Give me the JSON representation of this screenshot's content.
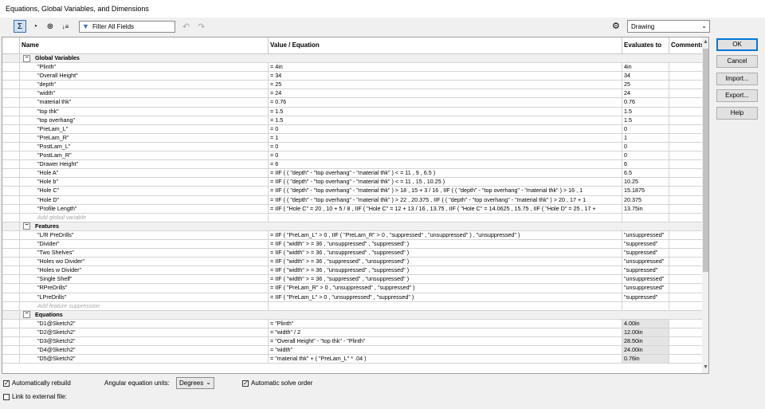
{
  "window": {
    "title": "Equations, Global Variables, and Dimensions"
  },
  "toolbar": {
    "filter_placeholder": "Filter All Fields",
    "configuration": "Drawing",
    "buttons": [
      "equation-view-icon",
      "sketch-equation-view-icon",
      "dimension-view-icon",
      "ordered-view-icon"
    ]
  },
  "columns": {
    "name": "Name",
    "value": "Value / Equation",
    "evaluates": "Evaluates to",
    "comments": "Comments"
  },
  "sections": [
    {
      "title": "Global Variables",
      "add_label": "Add global variable",
      "rows": [
        {
          "name": "\"Plinth\"",
          "value": "= 4in",
          "eval": "4in"
        },
        {
          "name": "\"Overall Height\"",
          "value": "= 34",
          "eval": "34"
        },
        {
          "name": "\"depth\"",
          "value": "= 25",
          "eval": "25"
        },
        {
          "name": "\"width\"",
          "value": "= 24",
          "eval": "24"
        },
        {
          "name": "\"material thk\"",
          "value": "= 0.76",
          "eval": "0.76"
        },
        {
          "name": "\"top thk\"",
          "value": "= 1.5",
          "eval": "1.5"
        },
        {
          "name": "\"top overhang\"",
          "value": "= 1.5",
          "eval": "1.5"
        },
        {
          "name": "\"PreLam_L\"",
          "value": "= 0",
          "eval": "0"
        },
        {
          "name": "\"PreLam_R\"",
          "value": "= 1",
          "eval": "1"
        },
        {
          "name": "\"PostLam_L\"",
          "value": "= 0",
          "eval": "0"
        },
        {
          "name": "\"PostLam_R\"",
          "value": "= 0",
          "eval": "0"
        },
        {
          "name": "\"Drawer Height\"",
          "value": "= 6",
          "eval": "6"
        },
        {
          "name": "\"Hole A\"",
          "value": "= IIF ( ( \"depth\" - \"top overhang\" - \"material thk\" ) < = 11 , 9 , 6.5 )",
          "eval": "6.5"
        },
        {
          "name": "\"Hole b\"",
          "value": "= IIF ( ( \"depth\" - \"top overhang\" - \"material thk\" ) < = 11 , 15 , 10.25 )",
          "eval": "10.25"
        },
        {
          "name": "\"Hole C\"",
          "value": "= IIF ( ( \"depth\" - \"top overhang\" - \"material thk\" ) > 18 , 15 + 3 / 16 , IIF ( ( \"depth\" - \"top overhang\" - \"material thk\" ) > 16 , 1",
          "eval": "15.1875"
        },
        {
          "name": "\"Hole D\"",
          "value": "= IIF ( ( \"depth\" - \"top overhang\" - \"material thk\" ) > 22 , 20.375 , IIF ( ( \"depth\" - \"top overhang\" - \"material thk\" ) > 20 , 17 + 1",
          "eval": "20.375"
        },
        {
          "name": "\"Profile Length\"",
          "value": "= IIF ( \"Hole C\" = 20 , 10 + 5 / 8 , IIF ( \"Hole C\" = 12 + 13 / 16 , 13.75 , IIF ( \"Hole C\" = 14.0625 , 15.75 , IIF ( \"Hole D\" = 25 , 17 +",
          "eval": "13.75in"
        }
      ]
    },
    {
      "title": "Features",
      "add_label": "Add feature suppression",
      "rows": [
        {
          "name": "\"L/R PreDrills\"",
          "value": "= IIF ( \"PreLam_L\" > 0 , IIF ( \"PreLam_R\" > 0 , \"suppressed\" , \"unsuppressed\" ) , \"unsuppressed\" )",
          "eval": "\"unsuppressed\""
        },
        {
          "name": "\"Divider\"",
          "value": "= IIF ( \"width\" > = 36 , \"unsuppressed\" , \"suppressed\" )",
          "eval": "\"suppressed\""
        },
        {
          "name": "\"Two Shelves\"",
          "value": "= IIF ( \"width\" > = 36 , \"unsuppressed\" , \"suppressed\" )",
          "eval": "\"suppressed\""
        },
        {
          "name": "\"Holes wo Divider\"",
          "value": "= IIF ( \"width\" > = 36 , \"suppressed\" , \"unsuppressed\" )",
          "eval": "\"unsuppressed\""
        },
        {
          "name": "\"Holes w Divider\"",
          "value": "= IIF ( \"width\" > = 36 , \"unsuppressed\" , \"suppressed\" )",
          "eval": "\"suppressed\""
        },
        {
          "name": "\"Single Shelf\"",
          "value": "= IIF ( \"width\" > = 36 , \"suppressed\" , \"unsuppressed\" )",
          "eval": "\"unsuppressed\""
        },
        {
          "name": "\"RPreDrills\"",
          "value": "= IIF ( \"PreLam_R\" > 0 , \"unsuppressed\" , \"suppressed\" )",
          "eval": "\"unsuppressed\""
        },
        {
          "name": "\"LPreDrills\"",
          "value": "= IIF ( \"PreLam_L\" > 0 , \"unsuppressed\" , \"suppressed\" )",
          "eval": "\"suppressed\""
        }
      ]
    },
    {
      "title": "Equations",
      "add_label": "",
      "rows": [
        {
          "name": "\"D1@Sketch2\"",
          "value": "= \"Plinth\"",
          "eval": "4.00in"
        },
        {
          "name": "\"D2@Sketch2\"",
          "value": "= \"width\" / 2",
          "eval": "12.00in"
        },
        {
          "name": "\"D3@Sketch2\"",
          "value": "= \"Overall Height\" - \"top thk\" - \"Plinth\"",
          "eval": "28.50in"
        },
        {
          "name": "\"D4@Sketch2\"",
          "value": "= \"width\"",
          "eval": "24.00in"
        },
        {
          "name": "\"D5@Sketch2\"",
          "value": "= \"material thk\" + ( \"PreLam_L\" * .04 )",
          "eval": "0.76in"
        }
      ]
    }
  ],
  "buttons": {
    "ok": "OK",
    "cancel": "Cancel",
    "import": "Import...",
    "export": "Export...",
    "help": "Help"
  },
  "options": {
    "auto_rebuild": "Automatically rebuild",
    "angular_units_label": "Angular equation units:",
    "angular_units_value": "Degrees",
    "auto_solve": "Automatic solve order",
    "link_external": "Link to external file:"
  }
}
